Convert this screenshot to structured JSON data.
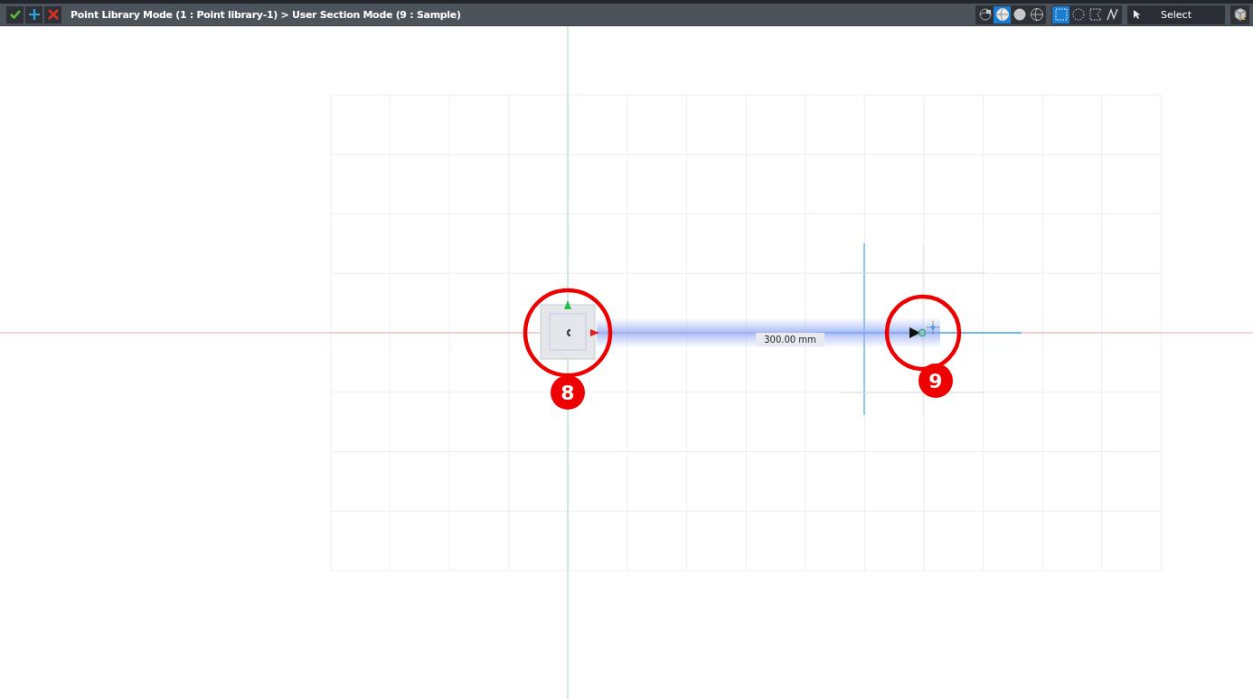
{
  "toolbar": {
    "actions": [
      {
        "kind": "confirm"
      },
      {
        "kind": "add"
      },
      {
        "kind": "cancel"
      }
    ],
    "breadcrumb": "Point Library Mode (1 : Point library-1) > User Section Mode (9 : Sample)",
    "view_modes": [
      {
        "kind": "lock-sphere",
        "selected": false
      },
      {
        "kind": "wire-sphere",
        "selected": true
      },
      {
        "kind": "solid-sphere",
        "selected": false
      },
      {
        "kind": "grid-sphere",
        "selected": false
      }
    ],
    "selection_modes": [
      {
        "kind": "rectangle",
        "selected": true
      },
      {
        "kind": "circle",
        "selected": false
      },
      {
        "kind": "lasso",
        "selected": false
      },
      {
        "kind": "freehand",
        "selected": false
      }
    ],
    "select_dropdown": "Select"
  },
  "canvas": {
    "dimension": "300.00 mm",
    "callouts": [
      {
        "label": "8"
      },
      {
        "label": "9"
      }
    ]
  }
}
